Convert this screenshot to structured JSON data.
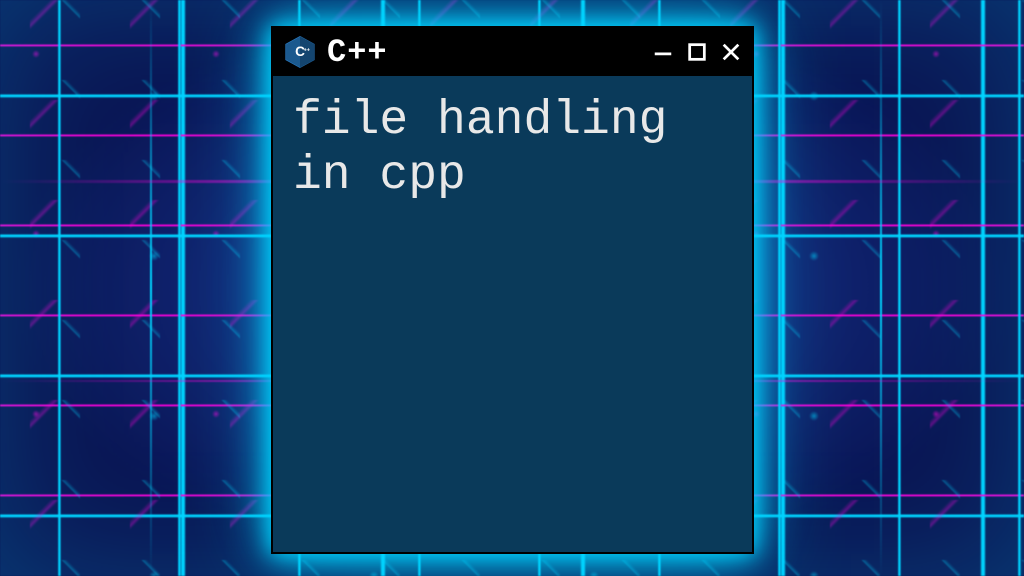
{
  "window": {
    "title": "C++",
    "icon": "cpp-hexagon-icon",
    "content_text": "file handling in cpp",
    "colors": {
      "titlebar_bg": "#000000",
      "content_bg": "#0a3a5a",
      "glow": "#00d4ff",
      "text": "#e8e8e8"
    },
    "controls": {
      "minimize": "minimize",
      "maximize": "maximize",
      "close": "close"
    }
  }
}
